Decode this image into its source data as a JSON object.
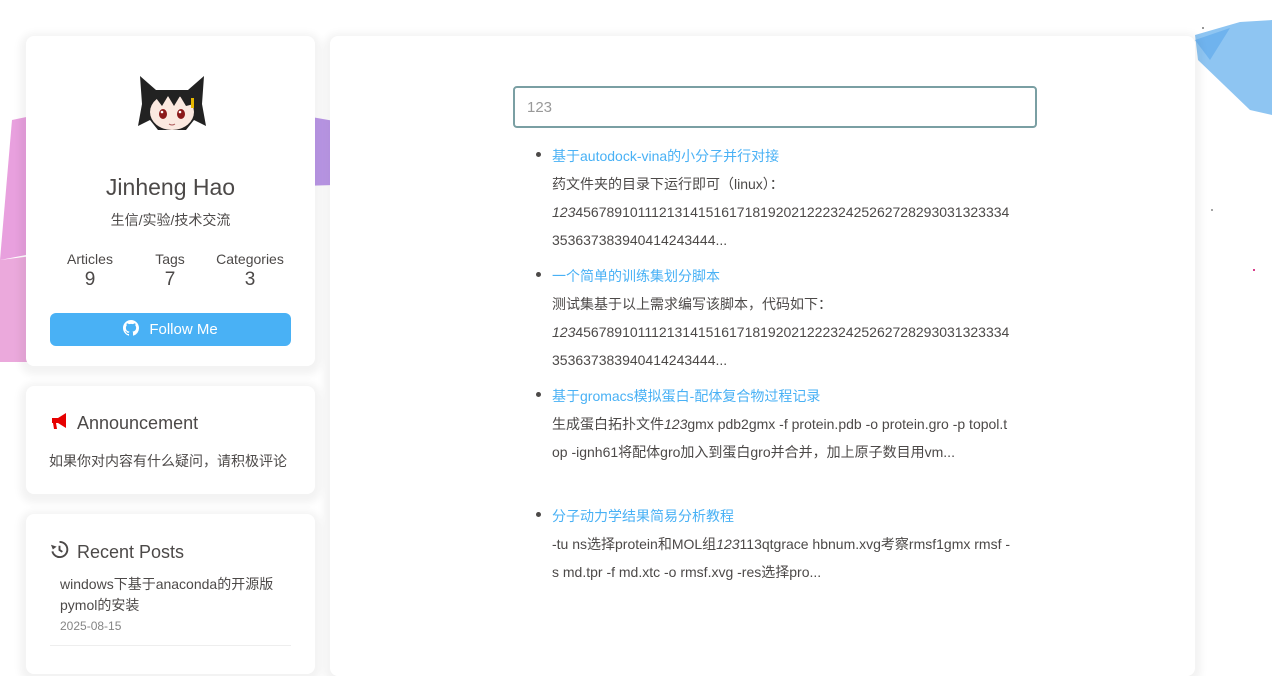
{
  "author": {
    "name": "Jinheng Hao",
    "description": "生信/实验/技术交流",
    "stats": [
      {
        "label": "Articles",
        "value": "9"
      },
      {
        "label": "Tags",
        "value": "7"
      },
      {
        "label": "Categories",
        "value": "3"
      }
    ],
    "follow_label": "Follow Me"
  },
  "announcement": {
    "title": "Announcement",
    "text": "如果你对内容有什么疑问，请积极评论"
  },
  "recent_posts": {
    "title": "Recent Posts",
    "items": [
      {
        "title": "windows下基于anaconda的开源版pymol的安装",
        "date": "2025-08-15"
      }
    ]
  },
  "search": {
    "value": "123"
  },
  "results": [
    {
      "title": "基于autodock-vina的小分子并行对接",
      "snippet_pre": "药文件夹的目录下运行即可（linux）：",
      "highlight": "123",
      "snippet_post": "45678910111213141516171819202122232425262728293031323334353637383940414243444..."
    },
    {
      "title": "一个简单的训练集划分脚本",
      "snippet_pre": "测试集基于以上需求编写该脚本，代码如下：",
      "highlight": "123",
      "snippet_post": "45678910111213141516171819202122232425262728293031323334353637383940414243444..."
    },
    {
      "title": "基于gromacs模拟蛋白-配体复合物过程记录",
      "snippet_pre": "生成蛋白拓扑文件",
      "highlight": "123",
      "snippet_post": "gmx pdb2gmx -f protein.pdb -o protein.gro -p topol.top -ignh61将配体gro加入到蛋白gro并合并，加上原子数目用vm..."
    },
    {
      "title": "分子动力学结果简易分析教程",
      "snippet_pre": "-tu ns选择protein和MOL组",
      "highlight": "123",
      "snippet_post": "113qtgrace hbnum.xvg考察rmsf1gmx rmsf -s md.tpr -f md.xtc -o rmsf.xvg -res选择pro..."
    }
  ],
  "colors": {
    "accent": "#49b1f5",
    "text": "#4c4948"
  }
}
